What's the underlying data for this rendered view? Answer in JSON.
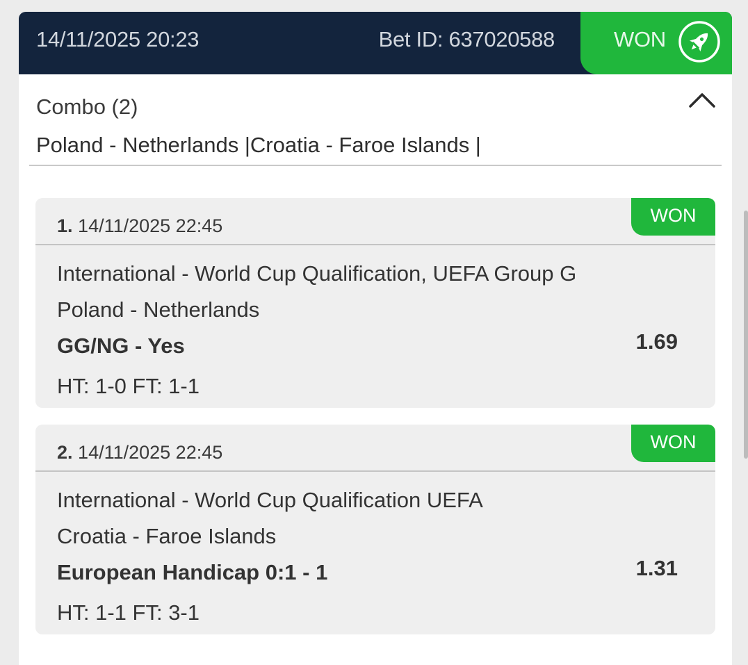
{
  "header": {
    "datetime": "14/11/2025 20:23",
    "bet_id": "Bet ID: 637020588",
    "status": "WON",
    "status_icon": "rocket-icon",
    "colors": {
      "header_bg": "#13243d",
      "status_green": "#20b73c"
    }
  },
  "combo": {
    "title": "Combo (2)",
    "matches": "Poland - Netherlands |Croatia - Faroe Islands |",
    "collapse_icon": "chevron-up-icon"
  },
  "legs": [
    {
      "index": "1.",
      "datetime": "14/11/2025 22:45",
      "status": "WON",
      "competition": "International - World Cup Qualification, UEFA Group G",
      "match": "Poland - Netherlands",
      "market": "GG/NG - Yes",
      "score": "HT: 1-0 FT: 1-1",
      "odds": "1.69"
    },
    {
      "index": "2.",
      "datetime": "14/11/2025 22:45",
      "status": "WON",
      "competition": "International - World Cup Qualification UEFA",
      "match": "Croatia - Faroe Islands",
      "market": "European Handicap 0:1 - 1",
      "score": "HT: 1-1 FT: 3-1",
      "odds": "1.31"
    }
  ]
}
